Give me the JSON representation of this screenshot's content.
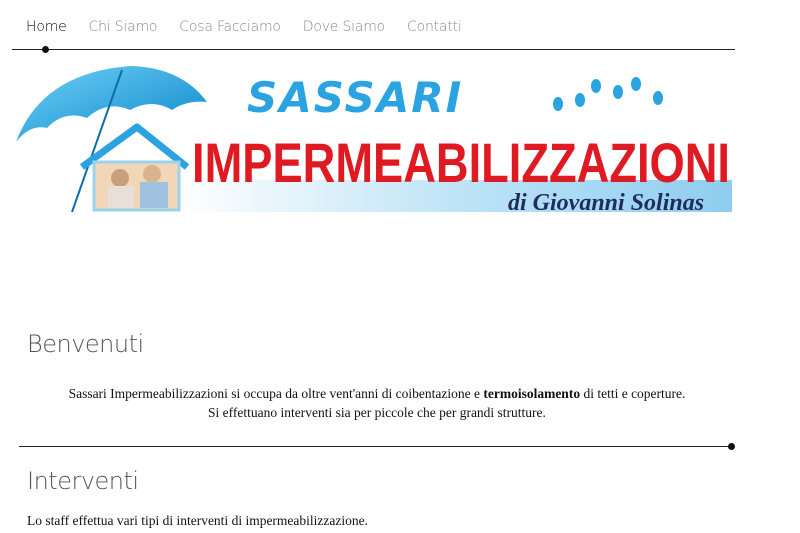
{
  "nav": {
    "items": [
      {
        "label": "Home",
        "active": true
      },
      {
        "label": "Chi Siamo",
        "active": false
      },
      {
        "label": "Cosa Facciamo",
        "active": false
      },
      {
        "label": "Dove Siamo",
        "active": false
      },
      {
        "label": "Contatti",
        "active": false
      }
    ]
  },
  "logo": {
    "line1": "SASSARI",
    "line2": "IMPERMEABILIZZAZIONI",
    "line3": "di Giovanni  Solinas",
    "colors": {
      "blue": "#2aa3e0",
      "red": "#e01a22",
      "navy": "#1f2d5c",
      "sky": "#cfeaf8"
    }
  },
  "welcome": {
    "heading": "Benvenuti",
    "line1_before": "Sassari Impermeabilizzazioni si occupa da oltre vent'anni di coibentazione e ",
    "line1_bold": "termoisolamento",
    "line1_after": " di tetti e coperture.",
    "line2": "Si effettuano interventi sia per piccole che per grandi strutture."
  },
  "interventi": {
    "heading": "Interventi",
    "text": "Lo staff effettua vari tipi di interventi di impermeabilizzazione."
  }
}
